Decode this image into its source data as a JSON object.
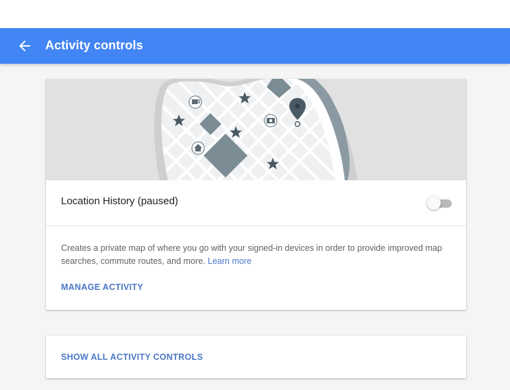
{
  "app_bar": {
    "title": "Activity controls",
    "back_icon": "arrow-left-icon",
    "color": "#4285f4"
  },
  "location_history": {
    "title": "Location History (paused)",
    "toggle_state": "off",
    "description": "Creates a private map of where you go with your signed-in devices in order to provide improved map searches, commute routes, and more.",
    "learn_more": "Learn more",
    "manage_label": "MANAGE ACTIVITY",
    "map_icons": [
      "star-icon",
      "coffee-icon",
      "camera-icon",
      "home-icon",
      "map-pin-icon"
    ]
  },
  "footer_card": {
    "label": "SHOW ALL ACTIVITY CONTROLS"
  },
  "colors": {
    "link": "#4a78c8",
    "background": "#f5f5f5"
  }
}
